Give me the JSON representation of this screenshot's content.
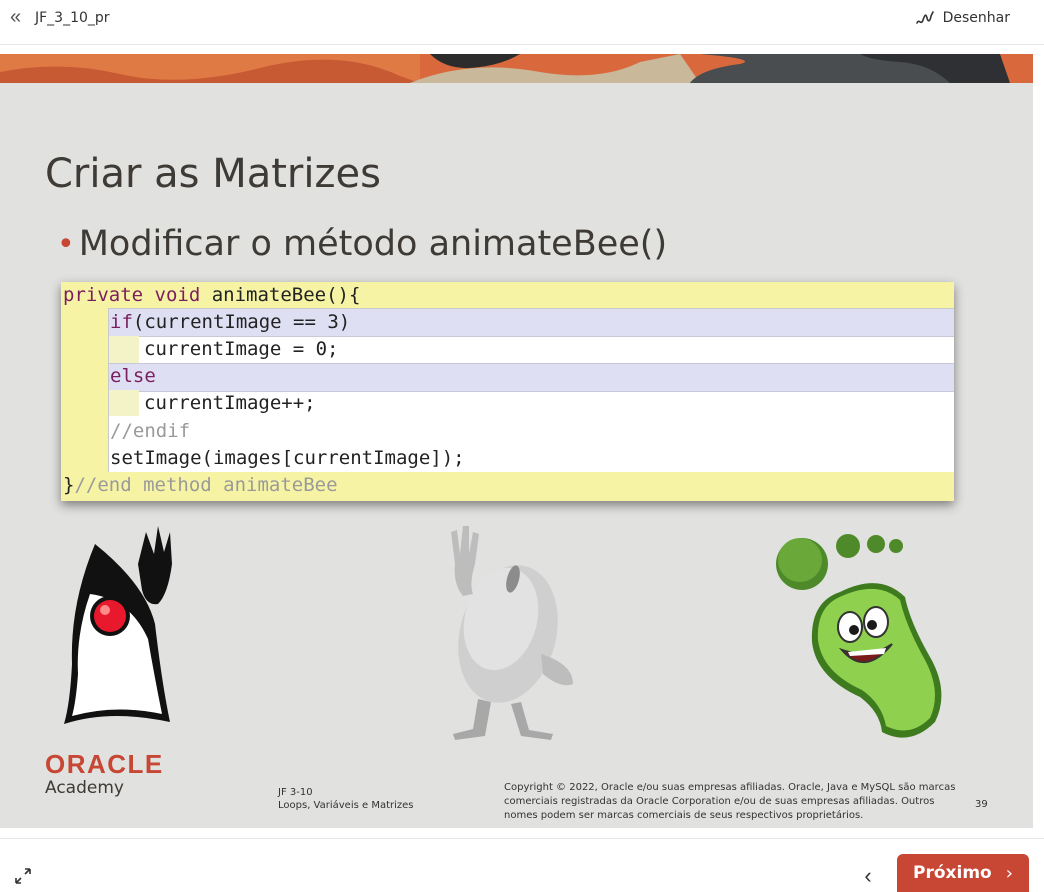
{
  "header": {
    "back_icon": "double-chevron-left-icon",
    "doc_title": "JF_3_10_pr",
    "draw_icon": "scribble-icon",
    "draw_label": "Desenhar"
  },
  "slide": {
    "title": "Criar as Matrizes",
    "bullet": "Modificar o método animateBee()",
    "code": {
      "line1_kw": "private void",
      "line1_rest": " animateBee(){",
      "line2_kw": "if",
      "line2_rest": "(currentImage == 3)",
      "line3": "currentImage = 0;",
      "line4_kw": "else",
      "line5": "currentImage++;",
      "line6": "//endif",
      "line7": "setImage(images[currentImage]);",
      "line8_brace": "}",
      "line8_comment": "//end method animateBee"
    },
    "footer": {
      "brand": "ORACLE",
      "brand_sub": "Academy",
      "course_code": "JF 3-10",
      "course_name": "Loops, Variáveis e Matrizes",
      "copyright": "Copyright © 2022, Oracle e/ou suas empresas afiliadas. Oracle, Java e MySQL são marcas comerciais registradas da Oracle Corporation e/ou de suas empresas afiliadas. Outros nomes podem ser marcas comerciais de seus respectivos proprietários.",
      "page_number": "39"
    },
    "colors": {
      "accent": "#c74634",
      "slide_bg": "#e1e1df",
      "code_bg": "#f6f4a4"
    }
  },
  "bottom": {
    "expand_icon": "expand-arrows-icon",
    "prev_icon": "chevron-left-icon",
    "next_label": "Próximo",
    "next_icon": "chevron-right-icon"
  }
}
